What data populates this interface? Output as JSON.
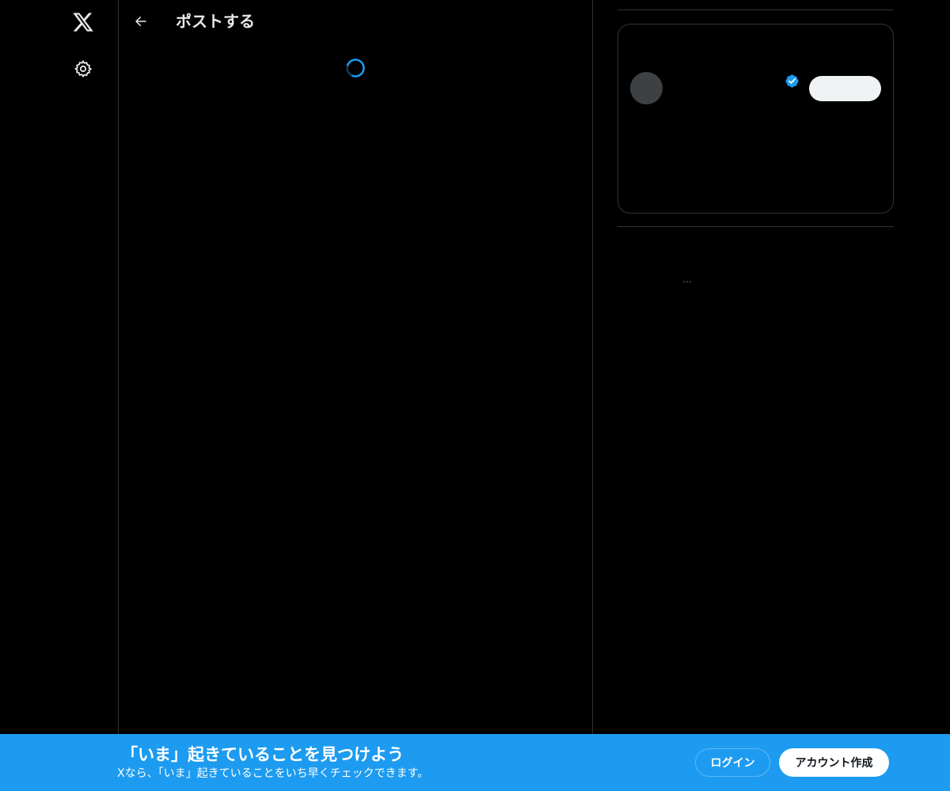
{
  "nav": {
    "logo_icon": "x-logo-icon",
    "settings_icon": "gear-icon"
  },
  "main": {
    "back_icon": "arrow-left-icon",
    "title": "ポストする",
    "loading_icon": "spinner-icon"
  },
  "sidebar": {
    "card": {
      "verified_icon": "verified-badge-icon",
      "follow_label": ""
    },
    "ellipsis": "…"
  },
  "banner": {
    "title": "「いま」起きていることを見つけよう",
    "subtitle": "Xなら、「いま」起きていることをいち早くチェックできます。",
    "login_label": "ログイン",
    "signup_label": "アカウント作成"
  },
  "colors": {
    "background": "#000000",
    "accent": "#1d9bf0",
    "border": "#2f3336",
    "text": "#e7e9ea"
  }
}
